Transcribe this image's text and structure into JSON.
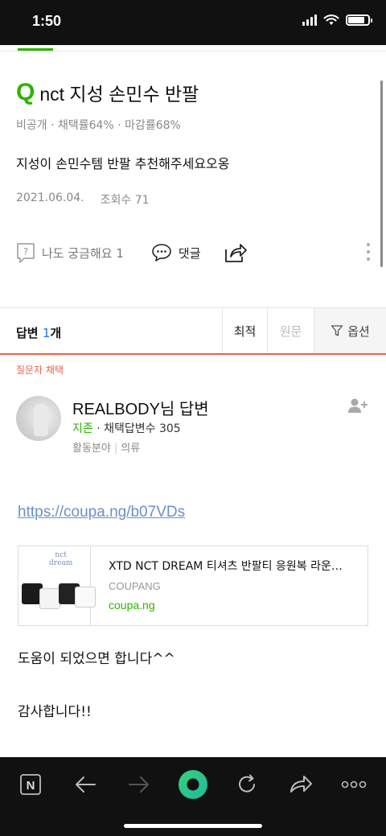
{
  "status_bar": {
    "time": "1:50",
    "battery_level": 0.85
  },
  "question": {
    "icon_letter": "Q",
    "title": "nct 지성 손민수 반팔",
    "meta": "비공개 · 채택률64% · 마감률68%",
    "body": "지성이 손민수템 반팔 추천해주세요오옹",
    "date": "2021.06.04.",
    "views": "조회수 71",
    "curious_label": "나도 궁금해요 1",
    "comment_label": "댓글"
  },
  "answers_bar": {
    "label_prefix": "답변",
    "count": "1",
    "label_suffix": "개",
    "sort_best": "최적",
    "sort_original": "원문",
    "options": "옵션"
  },
  "chosen_label": "질문자 채택",
  "answerer": {
    "name": "REALBODY님 답변",
    "grade": "지존",
    "stat": "· 채택답변수 305",
    "field_label": "활동분야",
    "field_value": "의류"
  },
  "answer": {
    "link": "https://coupa.ng/b07VDs",
    "card": {
      "thumb_text_1": "nct",
      "thumb_text_2": "dream",
      "title": "XTD NCT DREAM 티셔츠 반팔티 응원복 라운드티",
      "source": "COUPANG",
      "domain": "coupa.ng"
    },
    "p1": "도움이 되었으면 합니다^^",
    "p2": "감사합니다!!"
  },
  "colors": {
    "brand_green": "#2db400",
    "accent_red": "#e9634b",
    "link_blue": "#6b8fce"
  },
  "toolbar": {
    "icons": [
      "naver-n-icon",
      "back-arrow-icon",
      "forward-arrow-icon",
      "green-dot-icon",
      "refresh-icon",
      "share-icon",
      "more-icon"
    ],
    "naver_letter": "N"
  }
}
